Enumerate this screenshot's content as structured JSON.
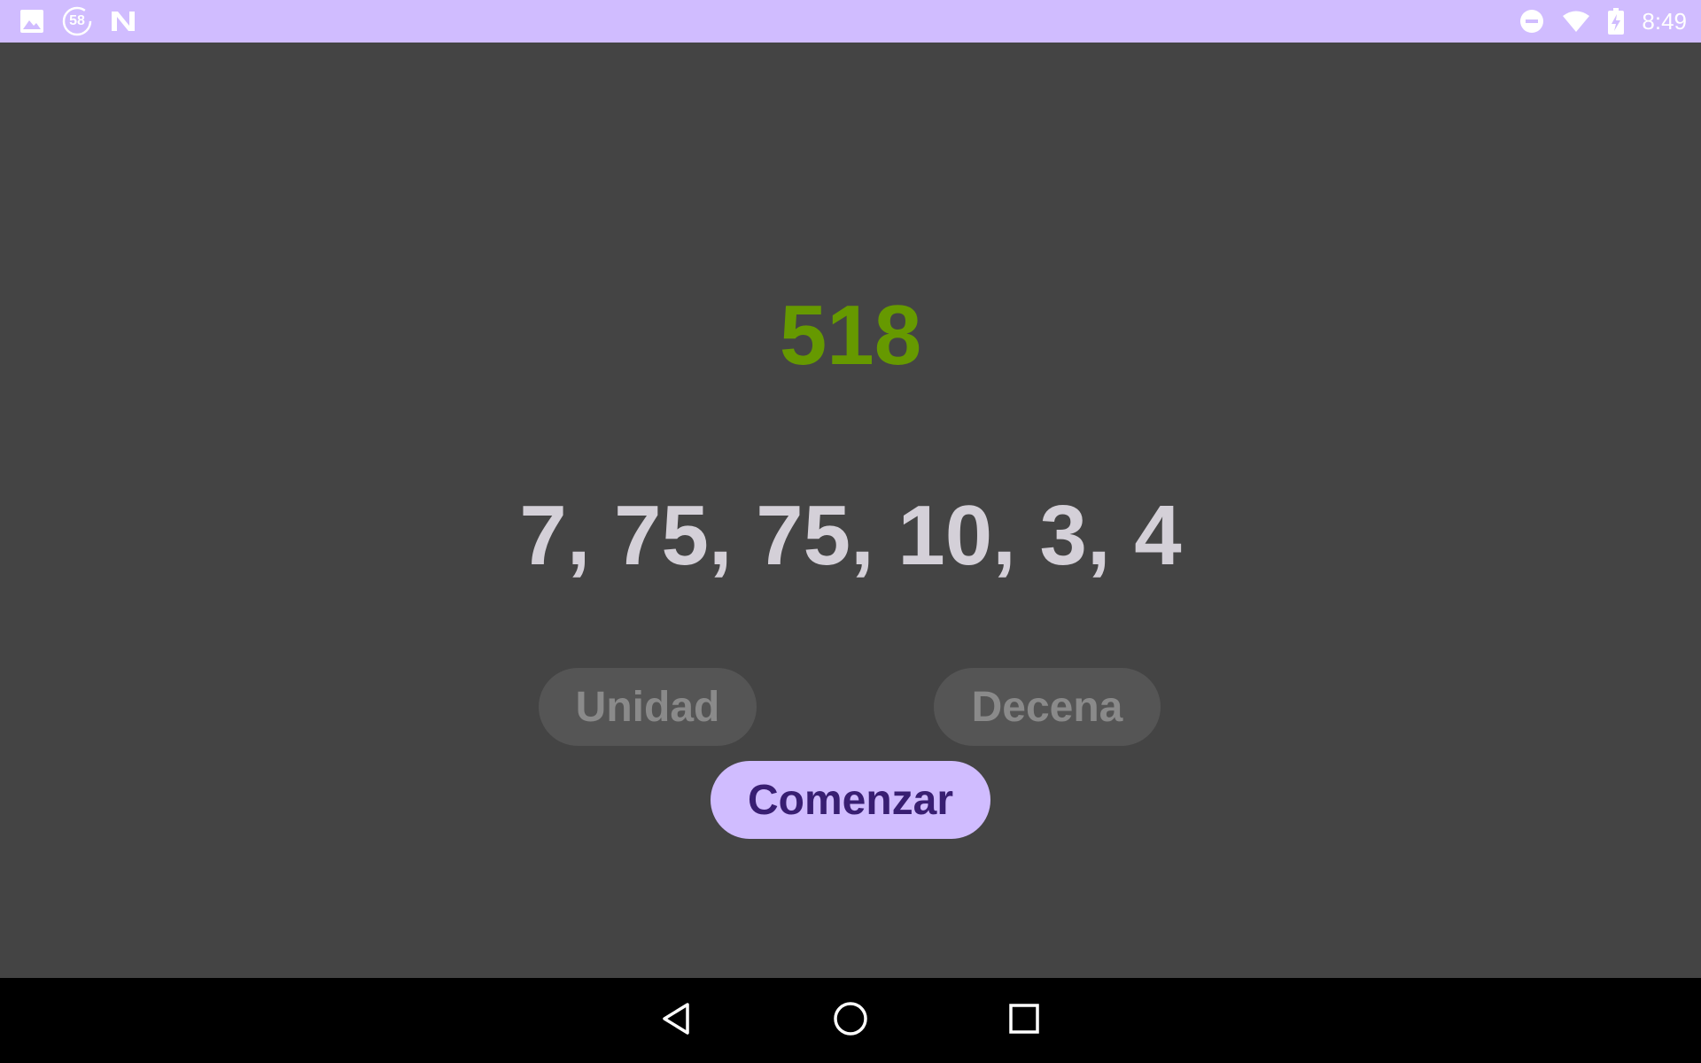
{
  "status_bar": {
    "notification_icons": [
      "image-icon",
      "timer-58-icon",
      "n-app-icon"
    ],
    "timer_badge": "58",
    "system_icons": [
      "do-not-disturb-icon",
      "wifi-icon",
      "battery-charging-icon"
    ],
    "time": "8:49",
    "background": "#d0bcff"
  },
  "game": {
    "target": "518",
    "target_color": "#669900",
    "numbers": "7, 75, 75, 10, 3, 4",
    "buttons": {
      "unidad": "Unidad",
      "decena": "Decena",
      "comenzar": "Comenzar"
    }
  },
  "nav_bar": {
    "icons": [
      "back-icon",
      "home-icon",
      "recents-icon"
    ]
  }
}
